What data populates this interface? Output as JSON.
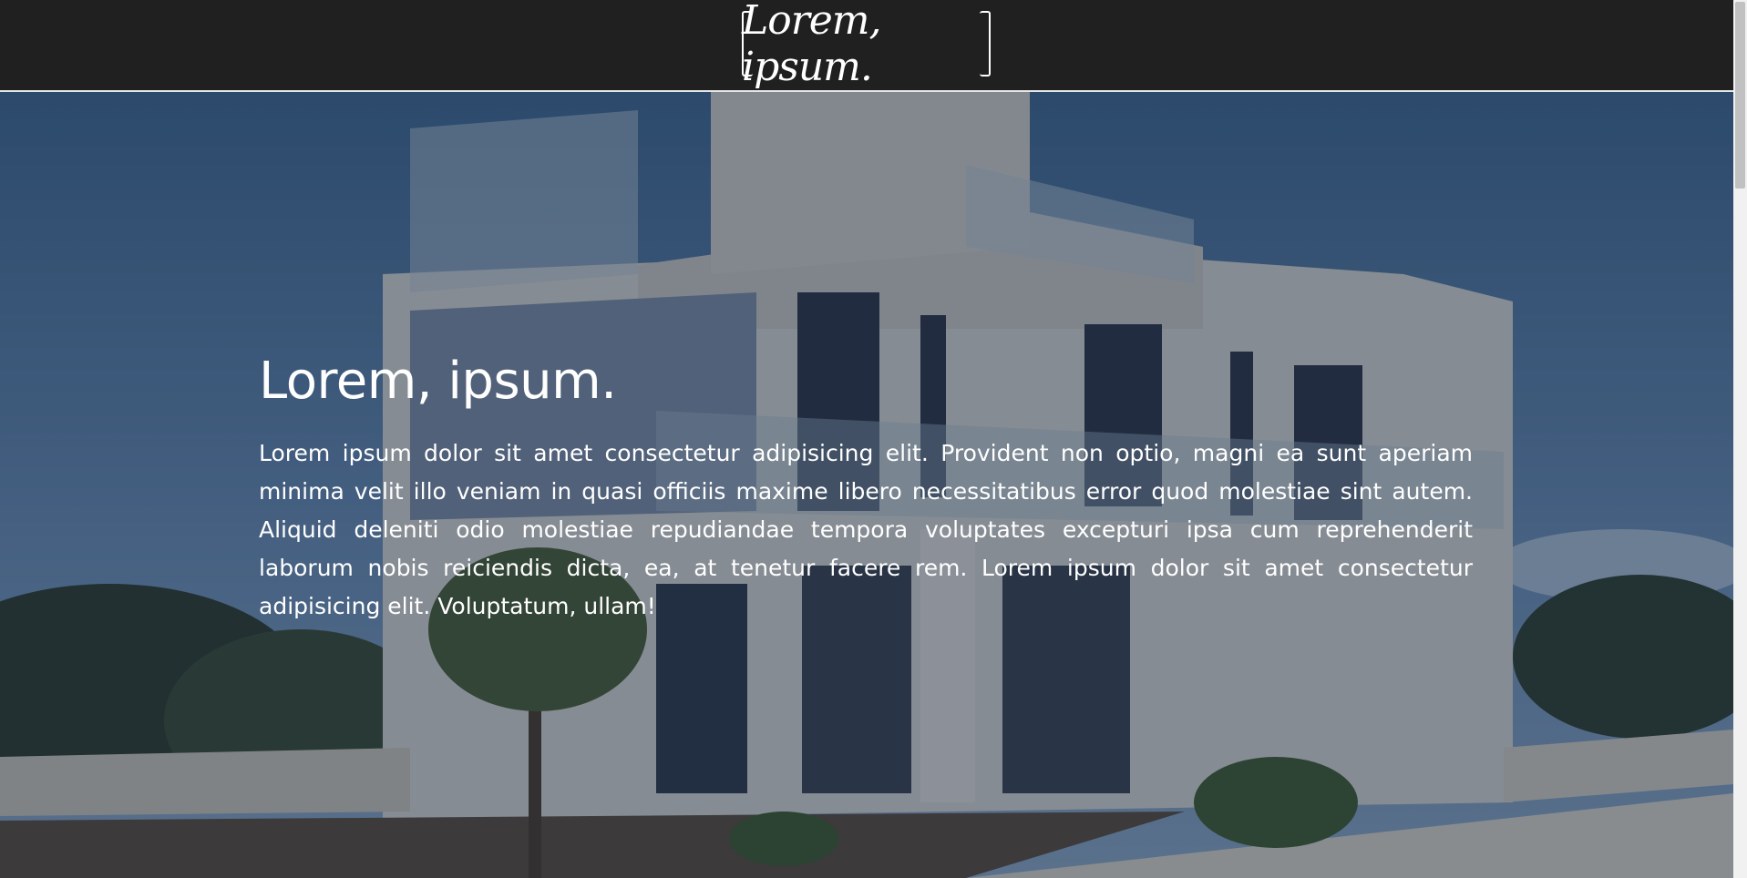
{
  "header": {
    "logo_text": "Lorem, ipsum."
  },
  "hero": {
    "title": "Lorem, ipsum.",
    "body": "Lorem ipsum dolor sit amet consectetur adipisicing elit. Provident non optio, magni ea sunt aperiam minima velit illo veniam in quasi officiis maxime libero necessitatibus error quod molestiae sint autem. Aliquid deleniti odio molestiae repudiandae tempora voluptates excepturi ipsa cum reprehenderit laborum nobis reiciendis dicta, ea, at tenetur facere rem. Lorem ipsum dolor sit amet consectetur adipisicing elit. Voluptatum, ullam!",
    "background_image": "modern-white-villa-photo"
  },
  "colors": {
    "header_bg": "#202020",
    "header_border": "#e6e6e6",
    "text": "#ffffff",
    "sky": "#4b6b8f"
  }
}
